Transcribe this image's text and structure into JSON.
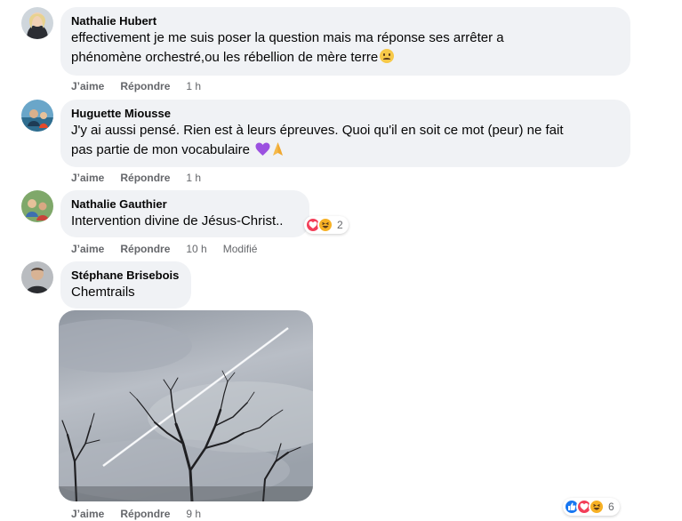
{
  "comments": [
    {
      "author": "Nathalie Hubert",
      "text_line1": "effectivement je me suis poser la question mais ma réponse ses arrêter a",
      "text_line2": "phénomène orchestré,ou les rébellion de mère terre",
      "emoji": "worried-face",
      "like_label": "J’aime",
      "reply_label": "Répondre",
      "time": "1 h"
    },
    {
      "author": "Huguette Miousse",
      "text_line1": "J'y ai aussi pensé. Rien est à leurs épreuves. Quoi qu'il en soit ce mot (peur) ne fait",
      "text_line2": "pas partie de mon vocabulaire",
      "emoji": "purple-heart, folded-hands",
      "like_label": "J’aime",
      "reply_label": "Répondre",
      "time": "1 h"
    },
    {
      "author": "Nathalie Gauthier",
      "text_line1": "Intervention divine de Jésus-Christ..",
      "like_label": "J’aime",
      "reply_label": "Répondre",
      "time": "10 h",
      "edited": "Modifié",
      "reactions": {
        "icons": [
          "love",
          "haha"
        ],
        "count": "2"
      }
    },
    {
      "author": "Stéphane Brisebois",
      "text_line1": "Chemtrails",
      "like_label": "J’aime",
      "reply_label": "Répondre",
      "time": "9 h",
      "reactions": {
        "icons": [
          "like",
          "love",
          "haha"
        ],
        "count": "6"
      }
    }
  ],
  "colors": {
    "bubble": "#f0f2f5",
    "meta_text": "#65676b",
    "like": "#1877f2",
    "love": "#f33e58",
    "haha": "#f7b125"
  }
}
